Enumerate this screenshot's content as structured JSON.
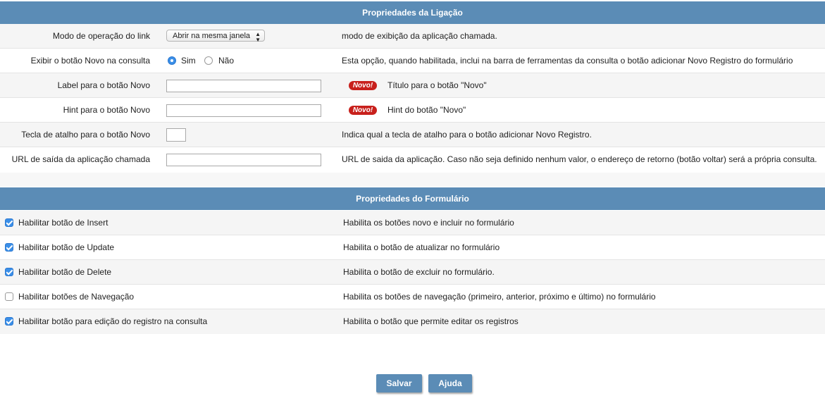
{
  "link_props": {
    "header": "Propriedades da Ligação",
    "rows": {
      "mode": {
        "label": "Modo de operação do link",
        "select_value": "Abrir na mesma janela",
        "description": "modo de exibição da aplicação chamada."
      },
      "show_new": {
        "label": "Exibir o botão Novo na consulta",
        "option_yes": "Sim",
        "option_no": "Não",
        "selected": "Sim",
        "description": "Esta opção, quando habilitada, inclui na barra de ferramentas da consulta o botão adicionar Novo Registro do formulário"
      },
      "new_label": {
        "label": "Label para o botão Novo",
        "value": "",
        "badge": "Novo!",
        "description": "Título para o botão \"Novo\""
      },
      "new_hint": {
        "label": "Hint para o botão Novo",
        "value": "",
        "badge": "Novo!",
        "description": "Hint do botão \"Novo\""
      },
      "shortcut": {
        "label": "Tecla de atalho para o botão Novo",
        "value": "",
        "description": "Indica qual a tecla de atalho para o botão adicionar Novo Registro."
      },
      "exit_url": {
        "label": "URL de saída da aplicação chamada",
        "value": "",
        "description": "URL de saida da aplicação. Caso não seja definido nenhum valor, o endereço de retorno (botão voltar) será a própria consulta."
      }
    }
  },
  "form_props": {
    "header": "Propriedades do Formulário",
    "items": [
      {
        "label": "Habilitar botão de Insert",
        "checked": true,
        "description": "Habilita os botões novo e incluir no formulário"
      },
      {
        "label": "Habilitar botão de Update",
        "checked": true,
        "description": "Habilita o botão de atualizar no formulário"
      },
      {
        "label": "Habilitar botão de Delete",
        "checked": true,
        "description": "Habilita o botão de excluir no formulário."
      },
      {
        "label": "Habilitar botões de Navegação",
        "checked": false,
        "description": "Habilita os botões de navegação (primeiro, anterior, próximo e último) no formulário"
      },
      {
        "label": "Habilitar botão para edição do registro na consulta",
        "checked": true,
        "description": "Habilita o botão que permite editar os registros"
      }
    ]
  },
  "actions": {
    "save_label": "Salvar",
    "help_label": "Ajuda"
  },
  "colors": {
    "header_bg": "#5b8cb6",
    "badge_red": "#c8201c",
    "check_blue": "#3b8fe8"
  }
}
